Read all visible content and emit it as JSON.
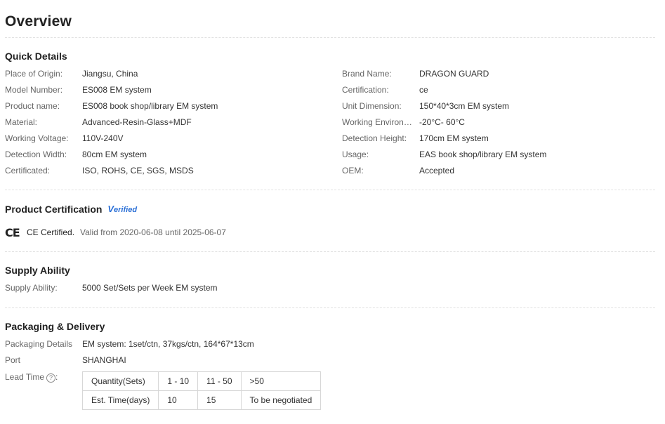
{
  "page_title": "Overview",
  "quick_details": {
    "title": "Quick Details",
    "left": [
      {
        "label": "Place of Origin:",
        "value": "Jiangsu, China"
      },
      {
        "label": "Model Number:",
        "value": "ES008 EM system"
      },
      {
        "label": "Product name:",
        "value": "ES008 book shop/library EM system"
      },
      {
        "label": "Material:",
        "value": "Advanced-Resin-Glass+MDF"
      },
      {
        "label": "Working Voltage:",
        "value": "110V-240V"
      },
      {
        "label": "Detection Width:",
        "value": "80cm EM system"
      },
      {
        "label": "Certificated:",
        "value": "ISO, ROHS, CE, SGS, MSDS"
      }
    ],
    "right": [
      {
        "label": "Brand Name:",
        "value": "DRAGON GUARD"
      },
      {
        "label": "Certification:",
        "value": "ce"
      },
      {
        "label": "Unit Dimension:",
        "value": "150*40*3cm EM system"
      },
      {
        "label": "Working Environme...",
        "value": "-20°C- 60°C"
      },
      {
        "label": "Detection Height:",
        "value": "170cm EM system"
      },
      {
        "label": "Usage:",
        "value": "EAS book shop/library EM system"
      },
      {
        "label": "OEM:",
        "value": "Accepted"
      }
    ]
  },
  "product_certification": {
    "title": "Product Certification",
    "badge_v": "V",
    "badge_rest": "erified",
    "mark": "CE",
    "name": "CE Certified.",
    "validity": "Valid from 2020-06-08 until 2025-06-07"
  },
  "supply_ability": {
    "title": "Supply Ability",
    "label": "Supply Ability:",
    "value": "5000 Set/Sets per Week EM system"
  },
  "packaging": {
    "title": "Packaging & Delivery",
    "details_label": "Packaging Details",
    "details_value": "EM system: 1set/ctn, 37kgs/ctn, 164*67*13cm",
    "port_label": "Port",
    "port_value": "SHANGHAI",
    "lead_time_label": "Lead Time",
    "help_glyph": "?",
    "lead_table": {
      "header": [
        "Quantity(Sets)",
        "1 - 10",
        "11 - 50",
        ">50"
      ],
      "row": [
        "Est. Time(days)",
        "10",
        "15",
        "To be negotiated"
      ]
    }
  }
}
